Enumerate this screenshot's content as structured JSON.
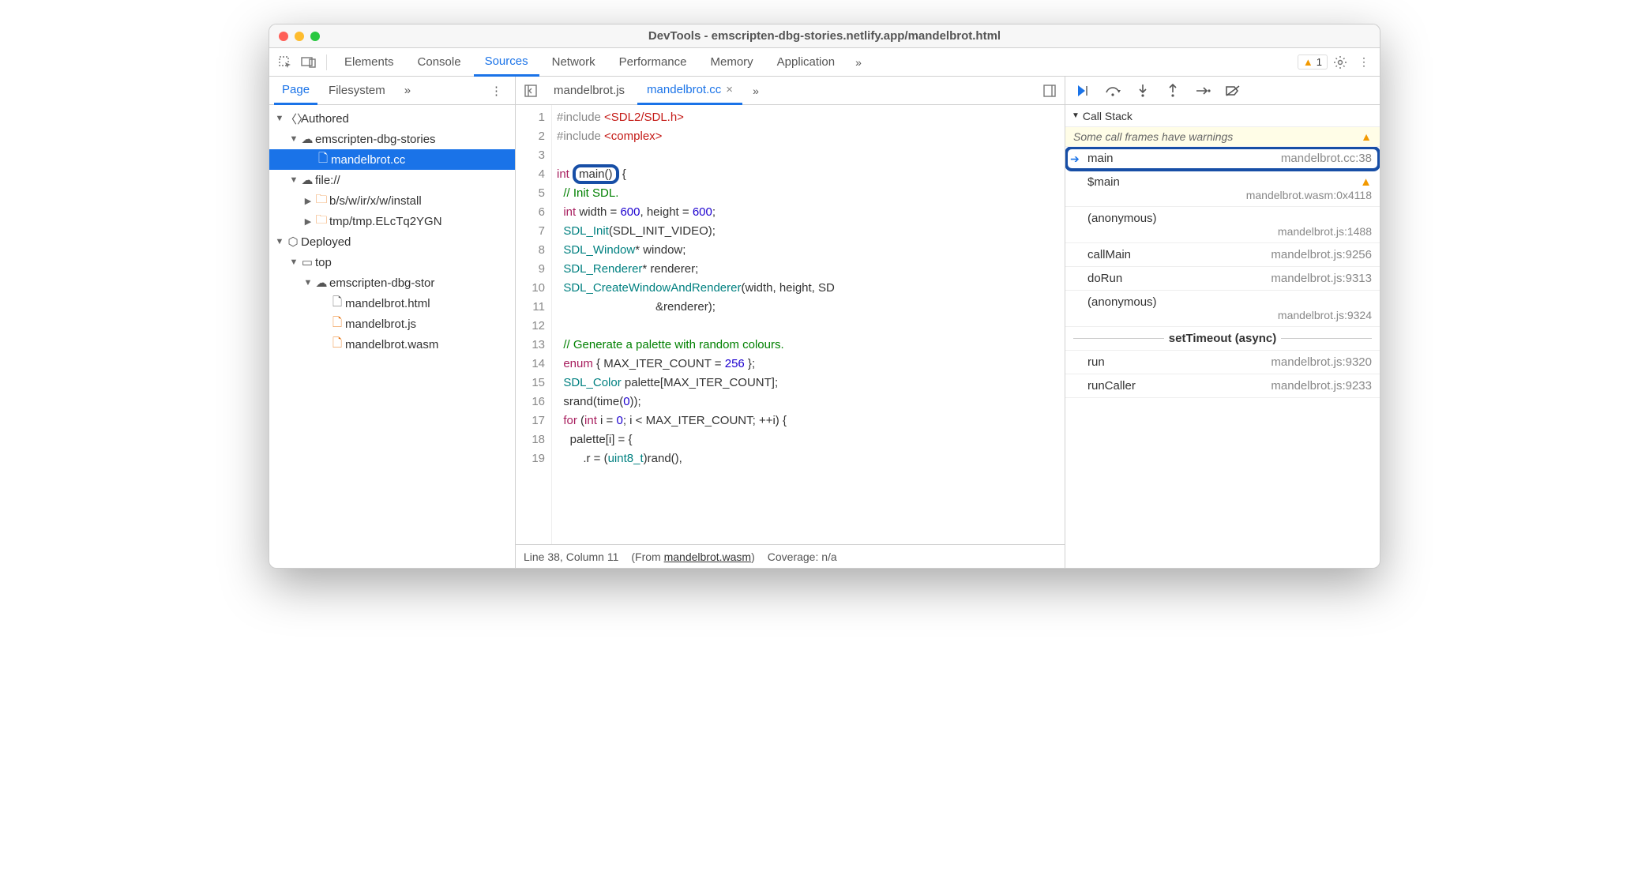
{
  "window": {
    "title": "DevTools - emscripten-dbg-stories.netlify.app/mandelbrot.html"
  },
  "mainTabs": {
    "items": [
      "Elements",
      "Console",
      "Sources",
      "Network",
      "Performance",
      "Memory",
      "Application"
    ],
    "active": "Sources",
    "warnCount": "1"
  },
  "navigator": {
    "tabs": [
      "Page",
      "Filesystem"
    ],
    "active": "Page",
    "tree": {
      "n0": "Authored",
      "n1": "emscripten-dbg-stories",
      "n2": "mandelbrot.cc",
      "n3": "file://",
      "n4": "b/s/w/ir/x/w/install",
      "n5": "tmp/tmp.ELcTq2YGN",
      "n6": "Deployed",
      "n7": "top",
      "n8": "emscripten-dbg-stor",
      "n9": "mandelbrot.html",
      "n10": "mandelbrot.js",
      "n11": "mandelbrot.wasm"
    }
  },
  "editor": {
    "tabs": [
      "mandelbrot.js",
      "mandelbrot.cc"
    ],
    "active": "mandelbrot.cc",
    "code": {
      "l1a": "#include ",
      "l1b": "<SDL2/SDL.h>",
      "l2a": "#include ",
      "l2b": "<complex>",
      "l3": "",
      "l4a": "int",
      "l4b": "main",
      "l4c": "()",
      "l4d": " {",
      "l5": "  // Init SDL.",
      "l6a": "  ",
      "l6b": "int",
      "l6c": " width = ",
      "l6d": "600",
      "l6e": ", height = ",
      "l6f": "600",
      "l6g": ";",
      "l7a": "  ",
      "l7b": "SDL_Init",
      "l7c": "(SDL_INIT_VIDEO);",
      "l8a": "  ",
      "l8b": "SDL_Window",
      "l8c": "* window;",
      "l9a": "  ",
      "l9b": "SDL_Renderer",
      "l9c": "* renderer;",
      "l10a": "  ",
      "l10b": "SDL_CreateWindowAndRenderer",
      "l10c": "(width, height, SD",
      "l11": "                              &renderer);",
      "l12": "",
      "l13": "  // Generate a palette with random colours.",
      "l14a": "  ",
      "l14b": "enum",
      "l14c": " { MAX_ITER_COUNT = ",
      "l14d": "256",
      "l14e": " };",
      "l15a": "  ",
      "l15b": "SDL_Color",
      "l15c": " palette[MAX_ITER_COUNT];",
      "l16a": "  srand(time(",
      "l16b": "0",
      "l16c": "));",
      "l17a": "  ",
      "l17b": "for",
      "l17c": " (",
      "l17d": "int",
      "l17e": " i = ",
      "l17f": "0",
      "l17g": "; i < MAX_ITER_COUNT; ++i) {",
      "l18": "    palette[i] = {",
      "l19a": "        .r = (",
      "l19b": "uint8_t",
      "l19c": ")rand(),"
    },
    "status": {
      "pos": "Line 38, Column 11",
      "from": "mandelbrot.wasm",
      "coverage": "Coverage: n/a"
    }
  },
  "debugger": {
    "callstackLabel": "Call Stack",
    "warning": "Some call frames have warnings",
    "asyncLabel": "setTimeout (async)",
    "frames": [
      {
        "fn": "main",
        "loc": "mandelbrot.cc:38",
        "current": true
      },
      {
        "fn": "$main",
        "loc": "",
        "sub": "mandelbrot.wasm:0x4118",
        "warn": true
      },
      {
        "fn": "(anonymous)",
        "loc": "",
        "sub": "mandelbrot.js:1488"
      },
      {
        "fn": "callMain",
        "loc": "mandelbrot.js:9256"
      },
      {
        "fn": "doRun",
        "loc": "mandelbrot.js:9313"
      },
      {
        "fn": "(anonymous)",
        "loc": "",
        "sub": "mandelbrot.js:9324"
      }
    ],
    "asyncFrames": [
      {
        "fn": "run",
        "loc": "mandelbrot.js:9320"
      },
      {
        "fn": "runCaller",
        "loc": "mandelbrot.js:9233"
      }
    ]
  }
}
